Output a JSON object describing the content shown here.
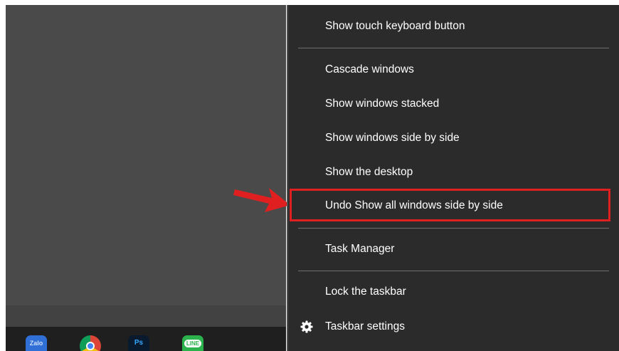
{
  "menu": {
    "items": [
      {
        "label": "Show touch keyboard button"
      },
      {
        "label": "Cascade windows"
      },
      {
        "label": "Show windows stacked"
      },
      {
        "label": "Show windows side by side"
      },
      {
        "label": "Show the desktop"
      },
      {
        "label": "Undo Show all windows side by side"
      },
      {
        "label": "Task Manager"
      },
      {
        "label": "Lock the taskbar"
      },
      {
        "label": "Taskbar settings",
        "icon": "gear-icon"
      }
    ]
  },
  "taskbar": {
    "apps": [
      {
        "name": "Zalo",
        "label": "Zalo"
      },
      {
        "name": "Chrome"
      },
      {
        "name": "Photoshop",
        "label": "Ps"
      },
      {
        "name": "LINE",
        "label": "LINE"
      }
    ]
  },
  "annotation": {
    "highlight_color": "#e02020",
    "arrow_color": "#e02020"
  }
}
